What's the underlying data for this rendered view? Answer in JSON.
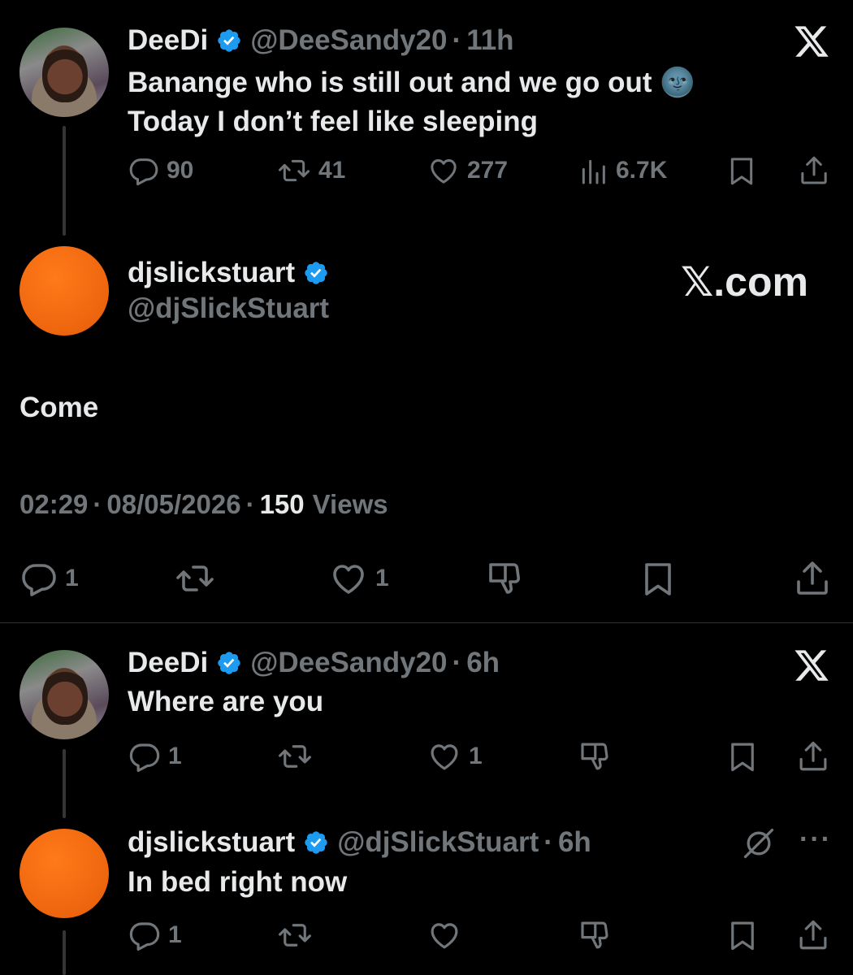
{
  "tweet1": {
    "author_name": "DeeDi",
    "handle": "@DeeSandy20",
    "time": "11h",
    "line1": "Banange who is still out and we go out 🌚",
    "line2": "Today I don’t feel like sleeping",
    "replies": "90",
    "reposts": "41",
    "likes": "277",
    "views": "6.7K"
  },
  "main": {
    "author_name": "djslickstuart",
    "handle": "@djSlickStuart",
    "brand": "𝕏.com",
    "text": "Come",
    "time": "02:29",
    "date": "08/05/2026",
    "views_count": "150",
    "views_label": "Views",
    "replies": "1",
    "likes": "1"
  },
  "reply1": {
    "author_name": "DeeDi",
    "handle": "@DeeSandy20",
    "time": "6h",
    "text": "Where are you",
    "replies": "1",
    "likes": "1"
  },
  "reply2": {
    "author_name": "djslickstuart",
    "handle": "@djSlickStuart",
    "time": "6h",
    "text": "In bed right now",
    "replies": "1"
  },
  "icons": {
    "verified": "verified-badge-icon",
    "x_logo": "x-logo-icon",
    "reply": "reply-icon",
    "repost": "repost-icon",
    "like": "heart-icon",
    "views": "views-icon",
    "bookmark": "bookmark-icon",
    "share": "share-icon",
    "dislike": "dislike-icon",
    "more": "more-icon",
    "grok": "grok-icon"
  },
  "colors": {
    "background": "#000000",
    "text": "#e7e9ea",
    "muted": "#71767b",
    "verified": "#1d9bf0",
    "avatar_orange": "#f26a10"
  }
}
